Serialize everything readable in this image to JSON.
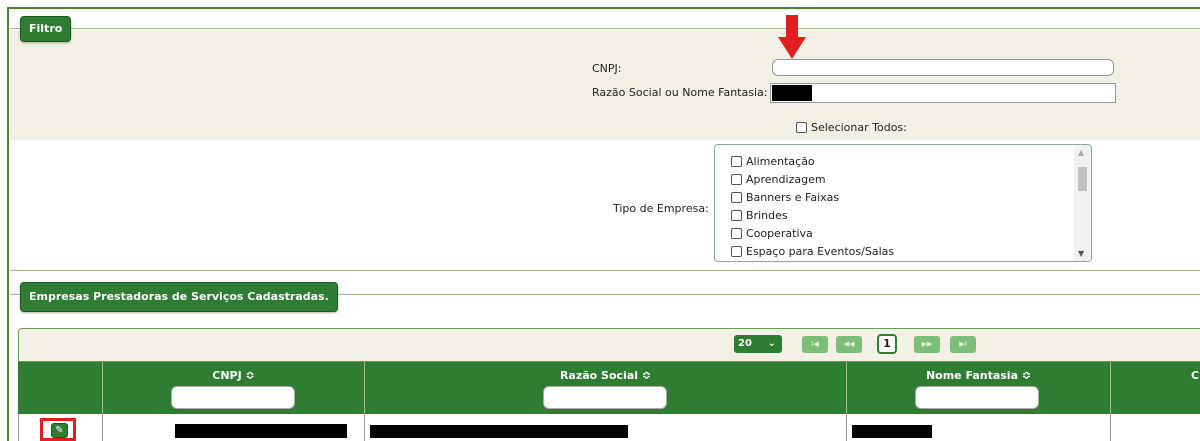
{
  "filter": {
    "legend": "Filtro",
    "cnpj_label": "CNPJ:",
    "razao_label": "Razão Social ou Nome Fantasia:",
    "select_all_label": "Selecionar Todos:",
    "tipo_label": "Tipo de Empresa:",
    "tipo_options": [
      "Alimentação",
      "Aprendizagem",
      "Banners e Faixas",
      "Brindes",
      "Cooperativa",
      "Espaço para Eventos/Salas"
    ]
  },
  "companies": {
    "legend": "Empresas Prestadoras de Serviços Cadastradas.",
    "page_size": "20",
    "current_page": "1",
    "pager_icons": [
      "first-page-icon",
      "prev-page-icon",
      "next-page-icon",
      "last-page-icon"
    ],
    "columns": [
      "CNPJ ≎",
      "Razão Social ≎",
      "Nome Fantasia ≎",
      "C"
    ]
  },
  "colors": {
    "primary_green": "#2e7d32",
    "highlight_red": "#e02020",
    "beige_band": "#f2efe5"
  },
  "icons": {
    "arrow": "red-down-arrow-icon",
    "edit": "edit-pencil-icon",
    "dropdown": "chevron-down-icon"
  }
}
